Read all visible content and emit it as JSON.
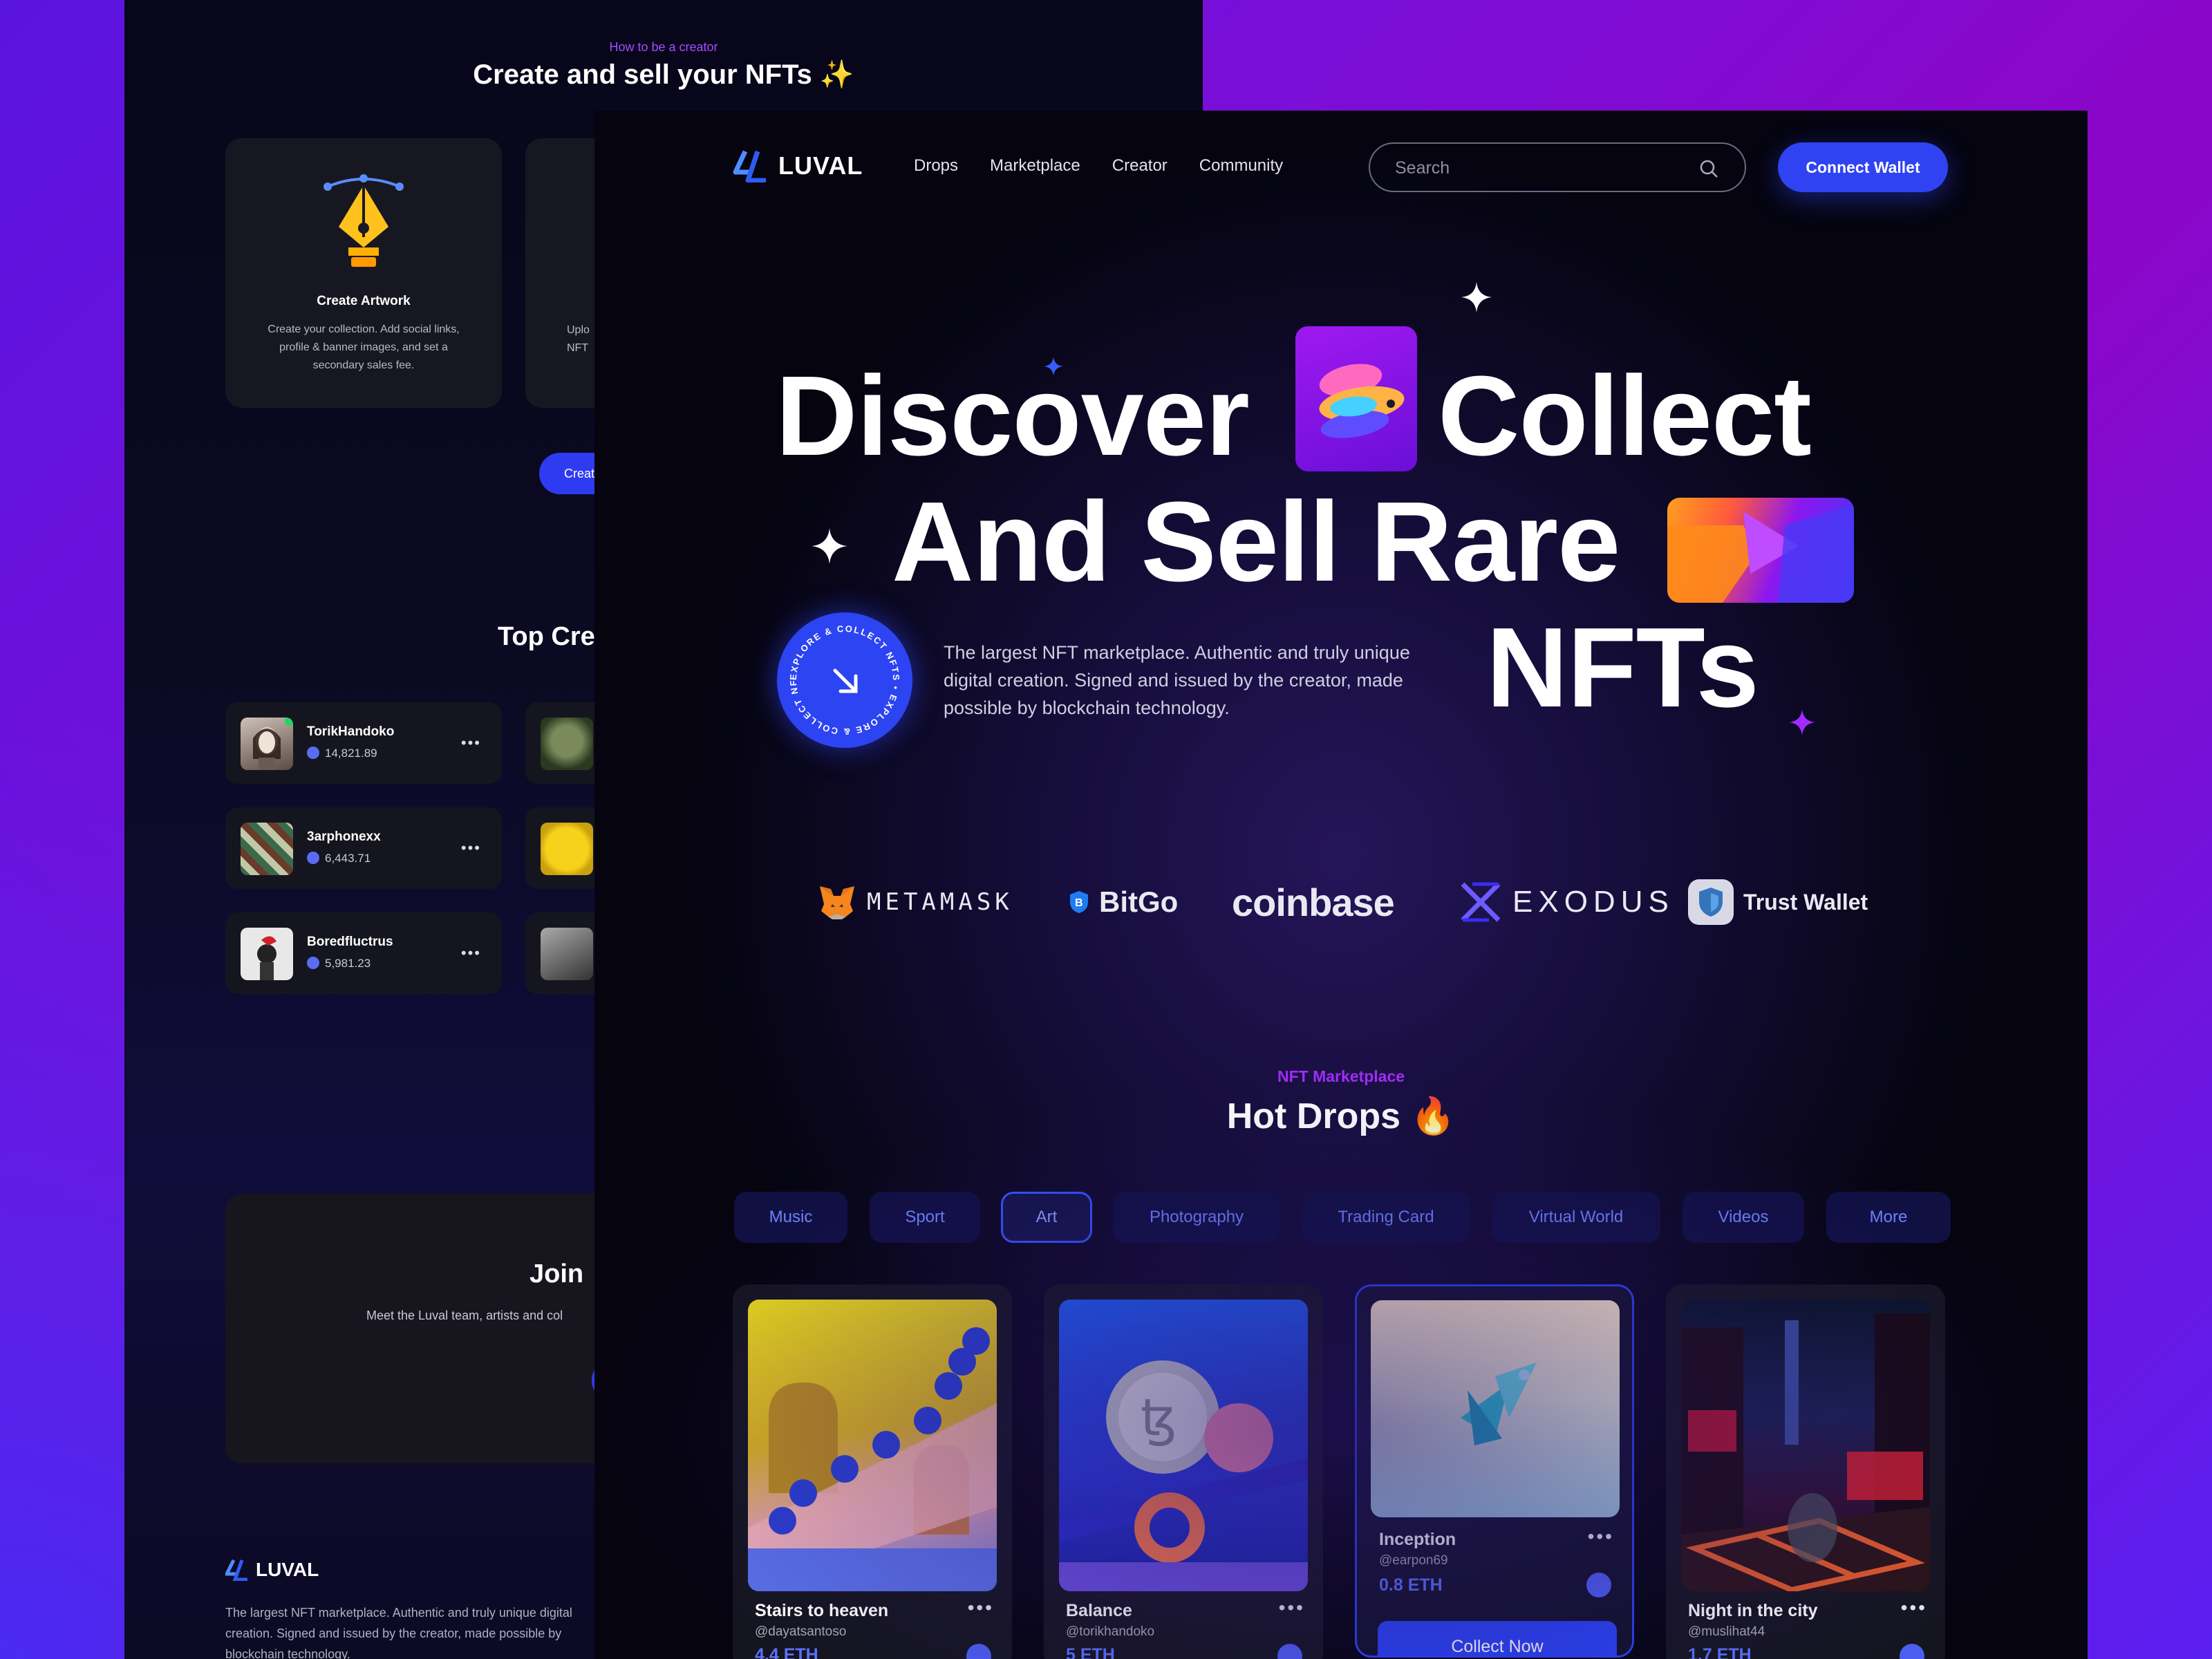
{
  "back_page": {
    "eyebrow": "How to be a creator",
    "title": "Create and sell your NFTs ✨",
    "step_card": {
      "title": "Create Artwork",
      "description": "Create your collection. Add social links, profile & banner images, and set a secondary sales fee."
    },
    "step_card_2_partial": "Uplo\nNFT",
    "create_button_partial": "Creat",
    "top_creators_partial": "Top Cre",
    "creators": [
      {
        "name": "TorikHandoko",
        "value": "14,821.89"
      },
      {
        "name": "3arphonexx",
        "value": "6,443.71"
      },
      {
        "name": "Boredfluctrus",
        "value": "5,981.23"
      }
    ],
    "join_title_partial": "Join",
    "join_desc_partial": "Meet the Luval team, artists and col",
    "footer_logo": "LUVAL",
    "footer_desc": "The largest NFT marketplace. Authentic and truly unique digital creation. Signed and issued by the creator, made possible by blockchain technology."
  },
  "nav": {
    "logo": "LUVAL",
    "links": [
      "Drops",
      "Marketplace",
      "Creator",
      "Community"
    ],
    "search_placeholder": "Search",
    "connect_label": "Connect Wallet"
  },
  "hero": {
    "line1_a": "Discover",
    "line1_b": "Collect",
    "line2": "And Sell Rare",
    "line3": "NFTs",
    "badge_text": "EXPLORE & COLLECT NFTS • EXPLORE & COLLECT NFTS •",
    "description": "The largest NFT marketplace. Authentic and truly unique digital creation. Signed and issued by the creator, made possible by blockchain technology."
  },
  "partners": [
    "METAMASK",
    "BitGo",
    "coinbase",
    "EXODUS",
    "Trust Wallet"
  ],
  "marketplace": {
    "eyebrow": "NFT Marketplace",
    "title": "Hot Drops 🔥",
    "categories": [
      "Music",
      "Sport",
      "Art",
      "Photography",
      "Trading Card",
      "Virtual World",
      "Videos",
      "More"
    ],
    "active_category": "Art",
    "items": [
      {
        "name": "Stairs to heaven",
        "handle": "@dayatsantoso",
        "price": "4.4 ETH"
      },
      {
        "name": "Balance",
        "handle": "@torikhandoko",
        "price": "5 ETH"
      },
      {
        "name": "Inception",
        "handle": "@earpon69",
        "price": "0.8 ETH",
        "action": "Collect Now"
      },
      {
        "name": "Night in the city",
        "handle": "@muslihat44",
        "price": "1.7 ETH"
      }
    ]
  },
  "colors": {
    "accent": "#2f43f3",
    "purple": "#a02cf5",
    "bg": "#05040f"
  }
}
